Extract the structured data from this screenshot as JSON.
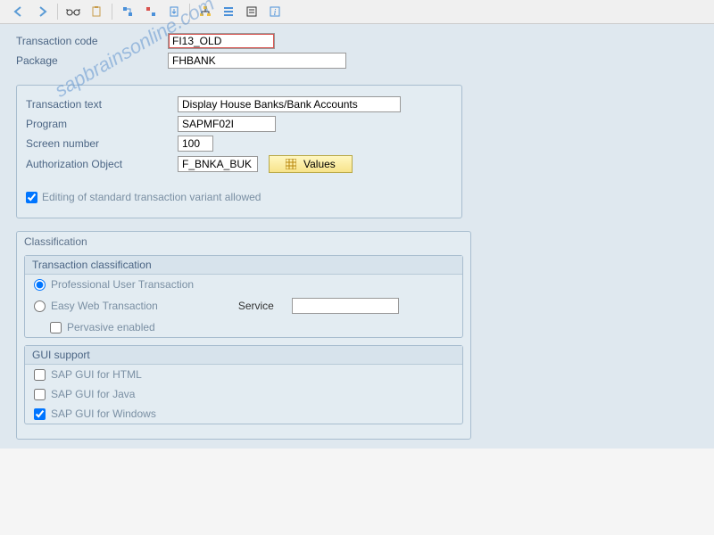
{
  "toolbar": {
    "icons": [
      "back-arrow-icon",
      "forward-arrow-icon",
      "sep",
      "glasses-icon",
      "clipboard-icon",
      "sep",
      "structure-icon",
      "wrench-icon",
      "export-icon",
      "sep",
      "hierarchy-icon",
      "align-icon",
      "properties-icon",
      "info-icon"
    ]
  },
  "header": {
    "tcode_label": "Transaction code",
    "tcode_value": "FI13_OLD",
    "package_label": "Package",
    "package_value": "FHBANK"
  },
  "detail": {
    "ttext_label": "Transaction text",
    "ttext_value": "Display House Banks/Bank Accounts",
    "program_label": "Program",
    "program_value": "SAPMF02I",
    "screen_label": "Screen number",
    "screen_value": "100",
    "auth_label": "Authorization Object",
    "auth_value": "F_BNKA_BUK",
    "values_btn": "Values",
    "edit_variant_label": "Editing of standard transaction variant allowed",
    "edit_variant_checked": true
  },
  "classification": {
    "title": "Classification",
    "tc_title": "Transaction classification",
    "prof_label": "Professional User Transaction",
    "easy_label": "Easy Web Transaction",
    "service_label": "Service",
    "pervasive_label": "Pervasive enabled",
    "prof_selected": true
  },
  "gui": {
    "title": "GUI support",
    "html_label": "SAP GUI for HTML",
    "java_label": "SAP GUI for Java",
    "win_label": "SAP GUI for Windows",
    "win_checked": true
  },
  "watermark": "sapbrainsonline.com"
}
